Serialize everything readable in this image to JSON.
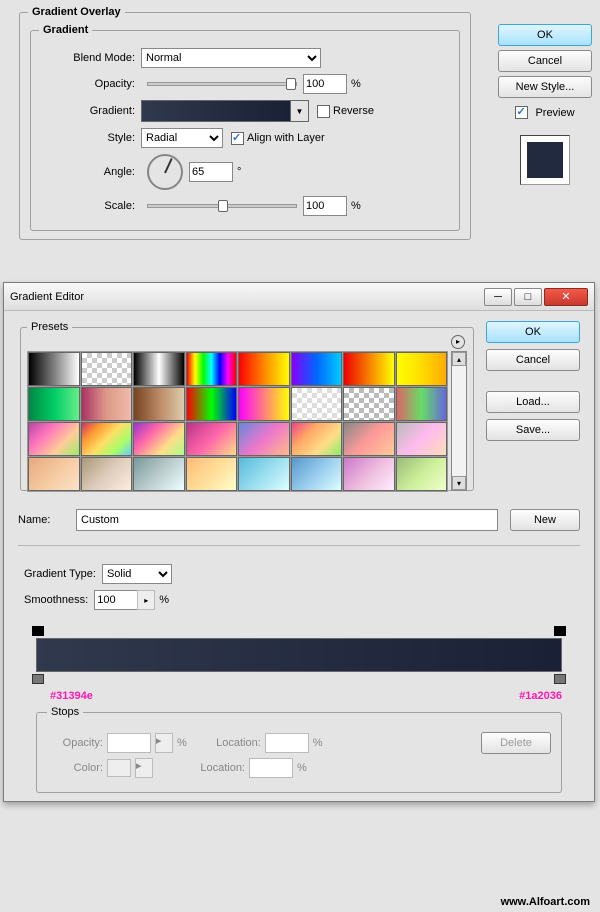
{
  "top": {
    "overlay_title": "Gradient Overlay",
    "gradient_title": "Gradient",
    "labels": {
      "blend": "Blend Mode:",
      "opacity": "Opacity:",
      "gradient": "Gradient:",
      "reverse": "Reverse",
      "style": "Style:",
      "align": "Align with Layer",
      "angle": "Angle:",
      "scale": "Scale:"
    },
    "values": {
      "blend": "Normal",
      "opacity": "100",
      "style": "Radial",
      "angle": "65",
      "scale": "100",
      "align_checked": true,
      "reverse_checked": false
    },
    "pct": "%",
    "deg": "°",
    "buttons": {
      "ok": "OK",
      "cancel": "Cancel",
      "newstyle": "New Style..."
    },
    "preview_chk": "Preview"
  },
  "ge": {
    "title": "Gradient Editor",
    "presets_title": "Presets",
    "buttons": {
      "ok": "OK",
      "cancel": "Cancel",
      "load": "Load...",
      "save": "Save...",
      "new": "New",
      "delete": "Delete"
    },
    "name_lbl": "Name:",
    "name_val": "Custom",
    "type_lbl": "Gradient Type:",
    "type_val": "Solid",
    "smooth_lbl": "Smoothness:",
    "smooth_val": "100",
    "pct": "%",
    "stops_title": "Stops",
    "opacity_lbl": "Opacity:",
    "location_lbl": "Location:",
    "color_lbl": "Color:",
    "hex_left": "#31394e",
    "hex_right": "#1a2036"
  },
  "footer": "www.Alfoart.com",
  "preset_swatches": [
    "linear-gradient(90deg,#000,#fff)",
    "repeating-conic-gradient(#ccc 0 25%,#fff 0 50%) 0 0/10px 10px",
    "linear-gradient(90deg,#000,#fff,#000)",
    "linear-gradient(90deg,red,yellow,lime,cyan,blue,magenta,red)",
    "linear-gradient(90deg,red,#f80,yellow)",
    "linear-gradient(90deg,#80f,#06f,#0cf)",
    "linear-gradient(90deg,#e00,#ff0)",
    "linear-gradient(90deg,#ff0,#fd0,#fa0)",
    "linear-gradient(90deg,#084,#0c6,#6e8)",
    "linear-gradient(90deg,#a36,#d98,#eba)",
    "linear-gradient(90deg,#742,#b86,#dca)",
    "linear-gradient(90deg,red,lime,blue)",
    "linear-gradient(90deg,#f0f,#ff0)",
    "repeating-conic-gradient(#ddd 0 25%,#fff 0 50%) 0 0/10px 10px",
    "repeating-conic-gradient(#bbb 0 25%,#fff 0 50%) 0 0/10px 10px",
    "linear-gradient(90deg,#d66,#6d6,#66d)",
    "linear-gradient(135deg,#b4a,#f7b,#fc9,#9e6)",
    "linear-gradient(135deg,#c36,#f93,#fd6,#af6,#6cf)",
    "linear-gradient(135deg,#93c,#f6a,#fd8,#af8)",
    "linear-gradient(135deg,#b38,#f6a,#fd8)",
    "linear-gradient(135deg,#68d,#e7c,#fb8)",
    "linear-gradient(135deg,#e48,#fa6,#fd8,#8e6)",
    "linear-gradient(135deg,#888,#f99,#fc9)",
    "linear-gradient(135deg,#bbb,#fbe,#fdb)",
    "linear-gradient(135deg,#e7a87d,#f5c99f,#fce3c8)",
    "linear-gradient(135deg,#a97,#dcb,#fed)",
    "linear-gradient(135deg,#799,#bcc,#eff)",
    "linear-gradient(135deg,#fb7,#fd9,#ffc)",
    "linear-gradient(135deg,#5bd,#9de,#dff)",
    "linear-gradient(135deg,#59c,#9ce,#dff)",
    "linear-gradient(135deg,#c7c,#ebd,#fef)",
    "linear-gradient(135deg,#9b7,#ce9,#efc)"
  ]
}
